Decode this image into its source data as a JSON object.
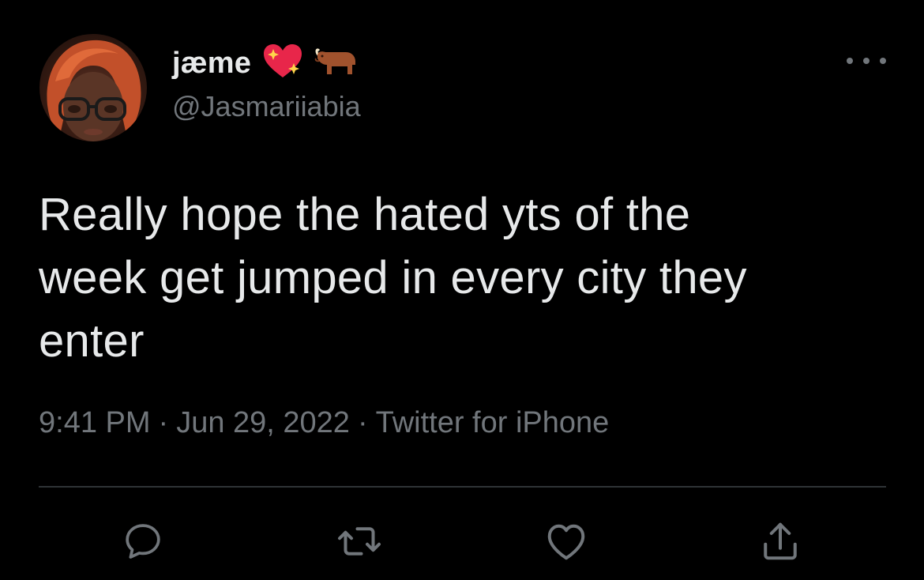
{
  "user": {
    "display_name": "jæme",
    "handle": "@Jasmariiabia",
    "name_emojis": [
      "sparkling-heart-emoji",
      "ox-emoji"
    ]
  },
  "tweet": {
    "text_lines": [
      "Really hope the hated yts of the",
      "week get jumped in every city they",
      "enter"
    ]
  },
  "meta": {
    "time": "9:41 PM",
    "separator": "·",
    "date": "Jun 29, 2022",
    "source": "Twitter for iPhone"
  },
  "actions": [
    {
      "name": "reply",
      "icon": "reply-icon"
    },
    {
      "name": "retweet",
      "icon": "retweet-icon"
    },
    {
      "name": "like",
      "icon": "heart-icon"
    },
    {
      "name": "share",
      "icon": "share-icon"
    }
  ],
  "colors": {
    "background": "#000000",
    "primary_text": "#e7e9ea",
    "secondary_text": "#71767b",
    "divider": "#2f3336"
  }
}
